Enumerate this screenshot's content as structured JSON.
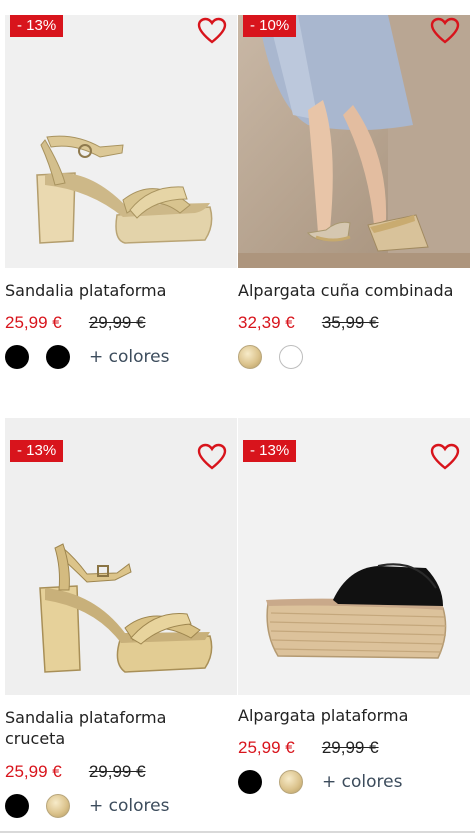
{
  "products": [
    {
      "discount": "- 13%",
      "title": "Sandalia plataforma",
      "price": "25,99 €",
      "old_price": "29,99 €",
      "swatches": [
        "black",
        "black"
      ],
      "more_label": "+ colores"
    },
    {
      "discount": "- 10%",
      "title": "Alpargata cuña combinada",
      "price": "32,39 €",
      "old_price": "35,99 €",
      "swatches": [
        "gold",
        "white"
      ],
      "more_label": ""
    },
    {
      "discount": "- 13%",
      "title_line1": "Sandalia plataforma",
      "title_line2": "cruceta",
      "price": "25,99 €",
      "old_price": "29,99 €",
      "swatches": [
        "black",
        "gold"
      ],
      "more_label": "+ colores"
    },
    {
      "discount": "- 13%",
      "title": "Alpargata plataforma",
      "price": "25,99 €",
      "old_price": "29,99 €",
      "swatches": [
        "black",
        "gold"
      ],
      "more_label": "+ colores"
    }
  ],
  "colors": {
    "accent_red": "#d8141c",
    "swatch_black": "#000000",
    "swatch_gold": "#dcc48e"
  },
  "icons": {
    "wishlist": "heart-outline-icon"
  }
}
